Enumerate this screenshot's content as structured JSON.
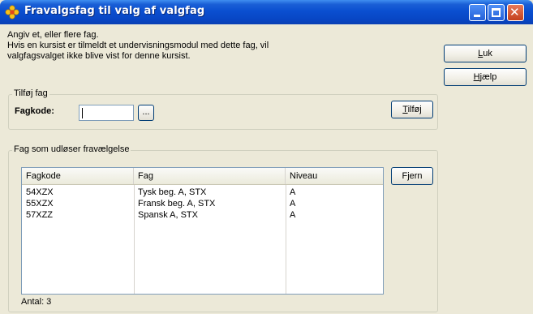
{
  "window": {
    "title": "Fravalgsfag til valg af valgfag",
    "app_icon": "flower-icon",
    "controls": [
      "minimize-icon",
      "maximize-icon",
      "close-icon"
    ]
  },
  "intro": {
    "line1": "Angiv et, eller flere fag.",
    "line2": "Hvis en kursist er tilmeldt et undervisningsmodul med dette fag, vil",
    "line3": "valgfagsvalget ikke blive vist for denne kursist."
  },
  "side_buttons": {
    "close_label": "Luk",
    "help_label": "Hjælp"
  },
  "add_group": {
    "legend": "Tilføj fag",
    "fagkode_label": "Fagkode:",
    "fagkode_value": "",
    "browse_label": "...",
    "add_label": "Tilføj"
  },
  "list_group": {
    "legend": "Fag som udløser fravælgelse",
    "remove_label": "Fjern",
    "columns": [
      "Fagkode",
      "Fag",
      "Niveau"
    ],
    "rows": [
      [
        "54XZX",
        "Tysk beg. A, STX",
        "A"
      ],
      [
        "55XZX",
        "Fransk beg. A, STX",
        "A"
      ],
      [
        "57XZZ",
        "Spansk A, STX",
        "A"
      ]
    ],
    "count_label": "Antal: 3"
  },
  "colors": {
    "titlebar": "#0a4fd0",
    "window_bg": "#ece9d8",
    "button_border": "#003c74"
  }
}
